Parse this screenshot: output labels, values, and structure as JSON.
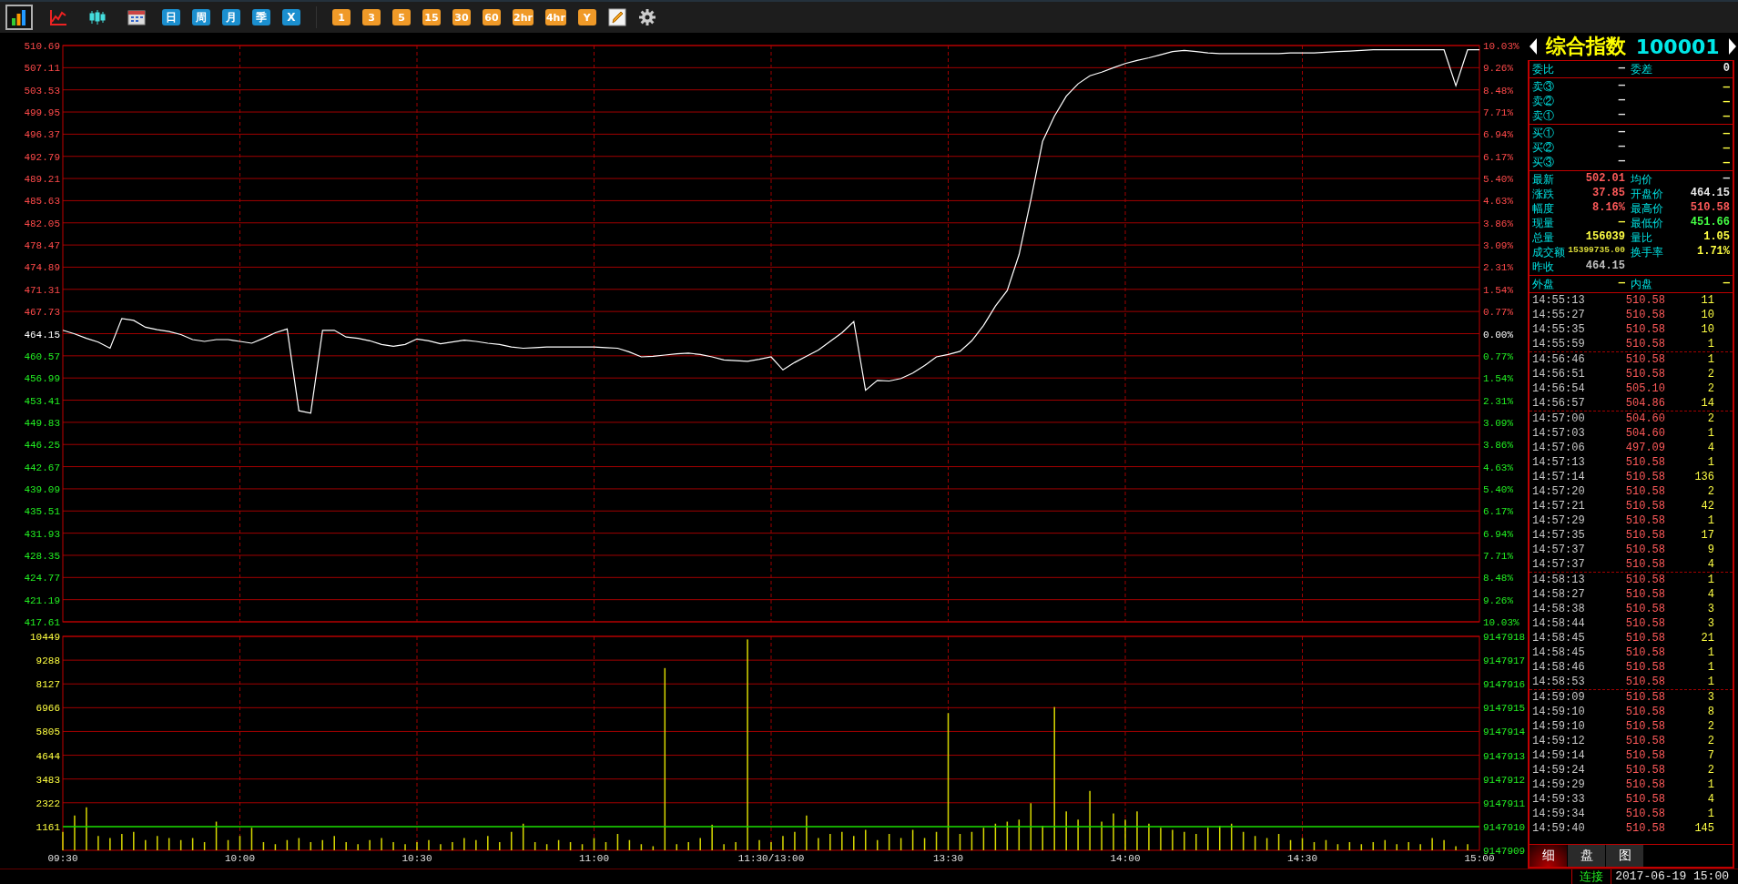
{
  "toolbar": {
    "view_buttons": [
      {
        "selected": true
      },
      {
        "selected": false
      },
      {
        "selected": false
      },
      {
        "selected": false
      }
    ],
    "period_buttons": [
      "日",
      "周",
      "月",
      "季",
      "X"
    ],
    "interval_buttons": [
      "1",
      "3",
      "5",
      "15",
      "30",
      "60",
      "2hr",
      "4hr",
      "Y"
    ]
  },
  "price_chart": {
    "chart_data": {
      "type": "line",
      "categories": [
        null,
        null,
        null,
        null,
        null,
        null,
        null,
        null,
        null,
        null,
        null,
        null,
        null,
        null,
        null,
        null,
        null,
        null,
        null,
        null,
        null,
        null,
        null,
        null,
        null,
        null,
        null,
        null,
        null,
        null,
        null,
        null,
        null,
        null,
        null,
        null,
        null,
        null,
        null,
        null,
        null,
        null,
        null,
        null,
        null,
        null,
        null,
        null,
        null,
        null,
        null,
        null,
        null,
        null,
        null,
        null,
        null,
        null,
        null,
        null,
        null,
        null,
        null,
        null,
        null,
        null,
        null,
        null,
        null,
        null,
        null,
        null,
        null,
        null,
        null,
        null,
        null,
        null,
        null,
        null,
        null,
        null,
        null,
        null,
        null,
        null,
        null,
        null,
        null,
        null,
        null,
        null,
        null,
        null,
        null,
        null,
        null,
        null,
        null,
        null,
        null,
        null,
        null,
        null,
        null,
        null,
        null,
        null,
        null,
        null,
        null,
        null,
        null,
        null,
        null,
        null,
        null,
        null,
        null,
        null,
        null
      ],
      "series": [
        {
          "color": "#ffffff",
          "values": [
            464.7,
            464.1,
            463.4,
            462.8,
            461.8,
            466.6,
            466.3,
            465.2,
            464.8,
            464.5,
            464.0,
            463.2,
            462.9,
            463.2,
            463.2,
            462.9,
            462.6,
            463.4,
            464.3,
            464.9,
            451.7,
            451.3,
            464.7,
            464.7,
            463.6,
            463.4,
            463.0,
            462.4,
            462.1,
            462.4,
            463.3,
            463.0,
            462.5,
            462.8,
            463.1,
            462.9,
            462.6,
            462.4,
            462.0,
            461.8,
            461.9,
            462.0,
            462.0,
            462.0,
            462.0,
            462.0,
            461.9,
            461.8,
            461.2,
            460.4,
            460.5,
            460.7,
            460.9,
            461.0,
            460.8,
            460.4,
            459.9,
            459.8,
            459.7,
            460.0,
            460.4,
            458.3,
            459.5,
            460.5,
            461.5,
            462.9,
            464.3,
            466.1,
            455.0,
            456.6,
            456.5,
            456.9,
            457.8,
            459.0,
            460.4,
            460.8,
            461.3,
            463.0,
            465.5,
            468.6,
            471.1,
            476.9,
            485.8,
            495.2,
            499.3,
            502.5,
            504.5,
            505.8,
            506.4,
            507.1,
            507.8,
            508.3,
            508.7,
            509.2,
            509.7,
            509.9,
            509.7,
            509.5,
            509.4,
            509.4,
            509.4,
            509.4,
            509.4,
            509.4,
            509.5,
            509.5,
            509.5,
            509.6,
            509.7,
            509.8,
            509.9,
            510.0,
            510.0,
            510.0,
            510.0,
            510.0,
            510.0,
            510.0,
            504.2,
            510.0,
            510.0
          ]
        }
      ],
      "ylim": [
        417.61,
        510.69
      ],
      "grid": true,
      "yticks": [
        510.69,
        507.11,
        503.53,
        499.95,
        496.37,
        492.79,
        489.21,
        485.63,
        482.05,
        478.47,
        474.89,
        471.31,
        467.73,
        464.15,
        460.57,
        456.99,
        453.41,
        449.83,
        446.25,
        442.67,
        439.09,
        435.51,
        431.93,
        428.35,
        424.77,
        421.19,
        417.61
      ]
    },
    "right_labels": [
      "10.03%",
      "9.26%",
      "8.48%",
      "7.71%",
      "6.94%",
      "6.17%",
      "5.40%",
      "4.63%",
      "3.86%",
      "3.09%",
      "2.31%",
      "1.54%",
      "0.77%",
      "0.00%",
      "0.77%",
      "1.54%",
      "2.31%",
      "3.09%",
      "3.86%",
      "4.63%",
      "5.40%",
      "6.17%",
      "6.94%",
      "7.71%",
      "8.48%",
      "9.26%",
      "10.03%"
    ]
  },
  "volume_chart": {
    "chart_data": {
      "type": "bar",
      "categories": [
        "09:30",
        null,
        null,
        null,
        null,
        null,
        null,
        null,
        null,
        null,
        null,
        null,
        null,
        null,
        null,
        "10:00",
        null,
        null,
        null,
        null,
        null,
        null,
        null,
        null,
        null,
        null,
        null,
        null,
        null,
        null,
        "10:30",
        null,
        null,
        null,
        null,
        null,
        null,
        null,
        null,
        null,
        null,
        null,
        null,
        null,
        null,
        "11:00",
        null,
        null,
        null,
        null,
        null,
        null,
        null,
        null,
        null,
        null,
        null,
        null,
        null,
        null,
        "11:30/13:00",
        null,
        null,
        null,
        null,
        null,
        null,
        null,
        null,
        null,
        null,
        null,
        null,
        null,
        null,
        "13:30",
        null,
        null,
        null,
        null,
        null,
        null,
        null,
        null,
        null,
        null,
        null,
        null,
        null,
        null,
        "14:00",
        null,
        null,
        null,
        null,
        null,
        null,
        null,
        null,
        null,
        null,
        null,
        null,
        null,
        null,
        "14:30",
        null,
        null,
        null,
        null,
        null,
        null,
        null,
        null,
        null,
        null,
        null,
        null,
        null,
        null,
        "15:00"
      ],
      "series": [
        {
          "color": "#d8d800",
          "values": [
            900,
            1700,
            2100,
            700,
            600,
            800,
            900,
            500,
            700,
            600,
            500,
            600,
            400,
            1400,
            500,
            700,
            1100,
            400,
            300,
            500,
            600,
            400,
            500,
            700,
            400,
            300,
            500,
            600,
            400,
            300,
            400,
            500,
            300,
            400,
            600,
            500,
            700,
            400,
            900,
            1300,
            400,
            300,
            500,
            400,
            300,
            600,
            400,
            800,
            500,
            300,
            200,
            8900,
            300,
            400,
            600,
            1250,
            300,
            400,
            10300,
            500,
            400,
            700,
            900,
            1700,
            600,
            800,
            900,
            700,
            1000,
            500,
            800,
            600,
            1000,
            600,
            900,
            6700,
            800,
            900,
            1100,
            1300,
            1400,
            1500,
            2300,
            1200,
            7000,
            1900,
            1500,
            2900,
            1400,
            1800,
            1500,
            1900,
            1300,
            1100,
            1000,
            900,
            800,
            1100,
            1200,
            1300,
            900,
            700,
            600,
            800,
            500,
            600,
            400,
            500,
            300,
            400,
            300,
            400,
            500,
            300,
            400,
            300,
            600,
            500,
            200,
            300,
            null
          ]
        }
      ],
      "ylim": [
        0,
        10449
      ],
      "yticks": [
        10449,
        9288,
        8127,
        6966,
        5805,
        4644,
        3483,
        2322,
        1161
      ],
      "grid": true,
      "ref_lines": [
        {
          "axis": "y",
          "value": 1161
        }
      ]
    },
    "right_labels": [
      "9147918",
      "9147917",
      "9147916",
      "9147915",
      "9147914",
      "9147913",
      "9147912",
      "9147911",
      "9147910",
      "9147909"
    ]
  },
  "quote_panel": {
    "name": "综合指数",
    "code": "100001",
    "sections": [
      [
        {
          "label": "委比",
          "value": {
            "text": "—",
            "color": "#e8e8e8"
          },
          "label2": "委差",
          "value2": {
            "text": "0",
            "color": "#e8e8e8"
          }
        }
      ],
      [
        {
          "label": "卖③",
          "value": {
            "text": "—",
            "color": "#e8e8e8"
          },
          "value2": {
            "text": "—",
            "color": "#ffff44"
          }
        },
        {
          "label": "卖②",
          "value": {
            "text": "—",
            "color": "#e8e8e8"
          },
          "value2": {
            "text": "—",
            "color": "#ffff44"
          }
        },
        {
          "label": "卖①",
          "value": {
            "text": "—",
            "color": "#e8e8e8"
          },
          "value2": {
            "text": "—",
            "color": "#ffff44"
          }
        }
      ],
      [
        {
          "label": "买①",
          "value": {
            "text": "—",
            "color": "#e8e8e8"
          },
          "value2": {
            "text": "—",
            "color": "#ffff44"
          }
        },
        {
          "label": "买②",
          "value": {
            "text": "—",
            "color": "#e8e8e8"
          },
          "value2": {
            "text": "—",
            "color": "#ffff44"
          }
        },
        {
          "label": "买③",
          "value": {
            "text": "—",
            "color": "#e8e8e8"
          },
          "value2": {
            "text": "—",
            "color": "#ffff44"
          }
        }
      ],
      [
        {
          "label": "最新",
          "value": {
            "text": "502.01",
            "color": "#ff5a5a"
          },
          "label2": "均价",
          "value2": {
            "text": "—",
            "color": "#e8e8e8"
          }
        },
        {
          "label": "涨跌",
          "value": {
            "text": "37.85",
            "color": "#ff5a5a"
          },
          "label2": "开盘价",
          "value2": {
            "text": "464.15",
            "color": "#e8e8e8"
          }
        },
        {
          "label": "幅度",
          "value": {
            "text": "8.16%",
            "color": "#ff5a5a"
          },
          "label2": "最高价",
          "value2": {
            "text": "510.58",
            "color": "#ff5a5a"
          }
        },
        {
          "label": "现量",
          "value": {
            "text": "—",
            "color": "#ffff44"
          },
          "label2": "最低价",
          "value2": {
            "text": "451.66",
            "color": "#44ff44"
          }
        },
        {
          "label": "总量",
          "value": {
            "text": "156039",
            "color": "#ffff44"
          },
          "label2": "量比",
          "value2": {
            "text": "1.05",
            "color": "#ffff44"
          }
        },
        {
          "label": "成交额",
          "value": {
            "text": "15399735.00",
            "color": "#dede3a",
            "kind": "small"
          },
          "label2": "换手率",
          "value2": {
            "text": "1.71%",
            "color": "#ffff44"
          }
        },
        {
          "label": "昨收",
          "value": {
            "text": "464.15",
            "color": "#c0c0c0"
          }
        }
      ],
      [
        {
          "label": "外盘",
          "value": {
            "text": "—",
            "color": "#ffff44"
          },
          "label2": "内盘",
          "value2": {
            "text": "—",
            "color": "#ffff44"
          }
        }
      ]
    ],
    "tick_groups": [
      [
        {
          "time": "14:55:13",
          "price": "510.58",
          "volume": "11"
        },
        {
          "time": "14:55:27",
          "price": "510.58",
          "volume": "10"
        },
        {
          "time": "14:55:35",
          "price": "510.58",
          "volume": "10"
        },
        {
          "time": "14:55:59",
          "price": "510.58",
          "volume": "1"
        }
      ],
      [
        {
          "time": "14:56:46",
          "price": "510.58",
          "volume": "1"
        },
        {
          "time": "14:56:51",
          "price": "510.58",
          "volume": "2"
        },
        {
          "time": "14:56:54",
          "price": "505.10",
          "volume": "2"
        },
        {
          "time": "14:56:57",
          "price": "504.86",
          "volume": "14"
        }
      ],
      [
        {
          "time": "14:57:00",
          "price": "504.60",
          "volume": "2"
        },
        {
          "time": "14:57:03",
          "price": "504.60",
          "volume": "1"
        },
        {
          "time": "14:57:06",
          "price": "497.09",
          "volume": "4"
        },
        {
          "time": "14:57:13",
          "price": "510.58",
          "volume": "1"
        },
        {
          "time": "14:57:14",
          "price": "510.58",
          "volume": "136"
        },
        {
          "time": "14:57:20",
          "price": "510.58",
          "volume": "2"
        },
        {
          "time": "14:57:21",
          "price": "510.58",
          "volume": "42"
        },
        {
          "time": "14:57:29",
          "price": "510.58",
          "volume": "1"
        },
        {
          "time": "14:57:35",
          "price": "510.58",
          "volume": "17"
        },
        {
          "time": "14:57:37",
          "price": "510.58",
          "volume": "9"
        },
        {
          "time": "14:57:37",
          "price": "510.58",
          "volume": "4"
        }
      ],
      [
        {
          "time": "14:58:13",
          "price": "510.58",
          "volume": "1"
        },
        {
          "time": "14:58:27",
          "price": "510.58",
          "volume": "4"
        },
        {
          "time": "14:58:38",
          "price": "510.58",
          "volume": "3"
        },
        {
          "time": "14:58:44",
          "price": "510.58",
          "volume": "3"
        },
        {
          "time": "14:58:45",
          "price": "510.58",
          "volume": "21"
        },
        {
          "time": "14:58:45",
          "price": "510.58",
          "volume": "1"
        },
        {
          "time": "14:58:46",
          "price": "510.58",
          "volume": "1"
        },
        {
          "time": "14:58:53",
          "price": "510.58",
          "volume": "1"
        }
      ],
      [
        {
          "time": "14:59:09",
          "price": "510.58",
          "volume": "3"
        },
        {
          "time": "14:59:10",
          "price": "510.58",
          "volume": "8"
        },
        {
          "time": "14:59:10",
          "price": "510.58",
          "volume": "2"
        },
        {
          "time": "14:59:12",
          "price": "510.58",
          "volume": "2"
        },
        {
          "time": "14:59:14",
          "price": "510.58",
          "volume": "7"
        },
        {
          "time": "14:59:24",
          "price": "510.58",
          "volume": "2"
        },
        {
          "time": "14:59:29",
          "price": "510.58",
          "volume": "1"
        },
        {
          "time": "14:59:33",
          "price": "510.58",
          "volume": "4"
        },
        {
          "time": "14:59:34",
          "price": "510.58",
          "volume": "1"
        },
        {
          "time": "14:59:40",
          "price": "510.58",
          "volume": "145"
        }
      ]
    ],
    "tabs": [
      {
        "label": "细",
        "selected": true
      },
      {
        "label": "盘",
        "selected": false
      },
      {
        "label": "图",
        "selected": false
      }
    ]
  },
  "status_bar": {
    "connection": "连接",
    "datetime": "2017-06-19 15:00"
  }
}
